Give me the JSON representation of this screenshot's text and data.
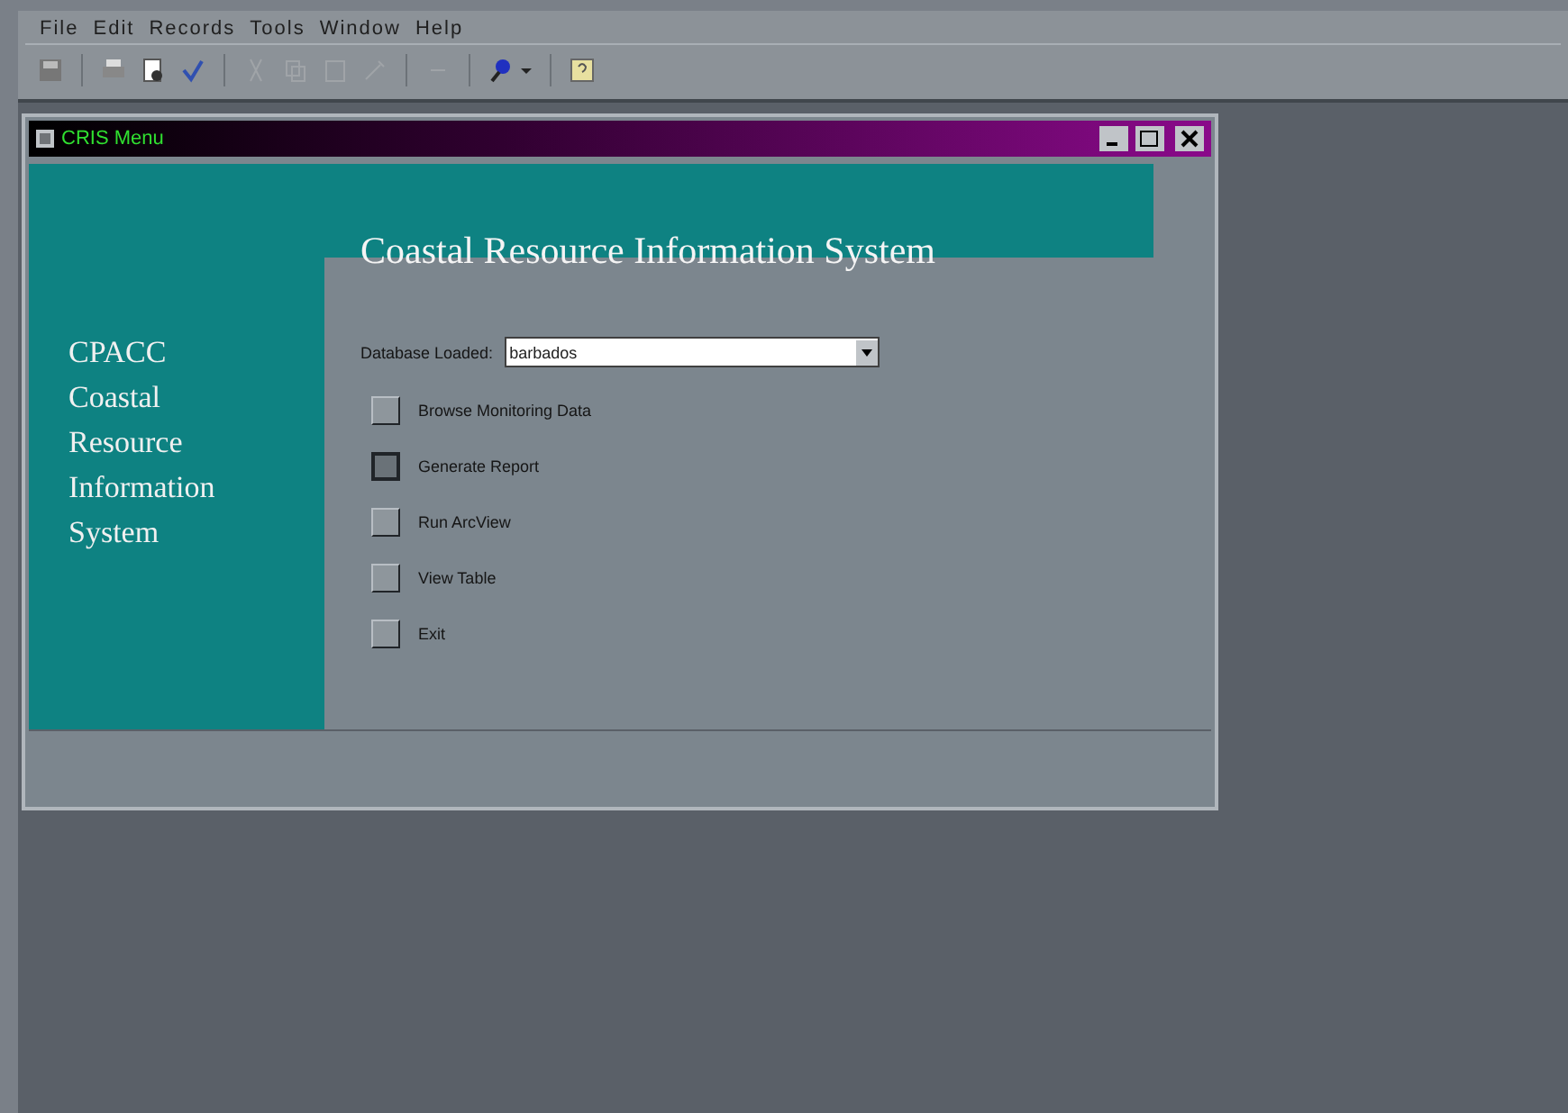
{
  "menu_bar": [
    "File",
    "Edit",
    "Records",
    "Tools",
    "Window",
    "Help"
  ],
  "window": {
    "title": "CRIS Menu"
  },
  "header": {
    "title": "Coastal Resource Information System"
  },
  "sidebar": {
    "lines": [
      "CPACC",
      "Coastal",
      "Resource",
      "Information",
      "System"
    ]
  },
  "database": {
    "label": "Database Loaded:",
    "value": "barbados"
  },
  "buttons": [
    {
      "label": "Browse Monitoring Data",
      "selected": false
    },
    {
      "label": "Generate Report",
      "selected": true
    },
    {
      "label": "Run ArcView",
      "selected": false
    },
    {
      "label": "View Table",
      "selected": false
    },
    {
      "label": "Exit",
      "selected": false
    }
  ]
}
